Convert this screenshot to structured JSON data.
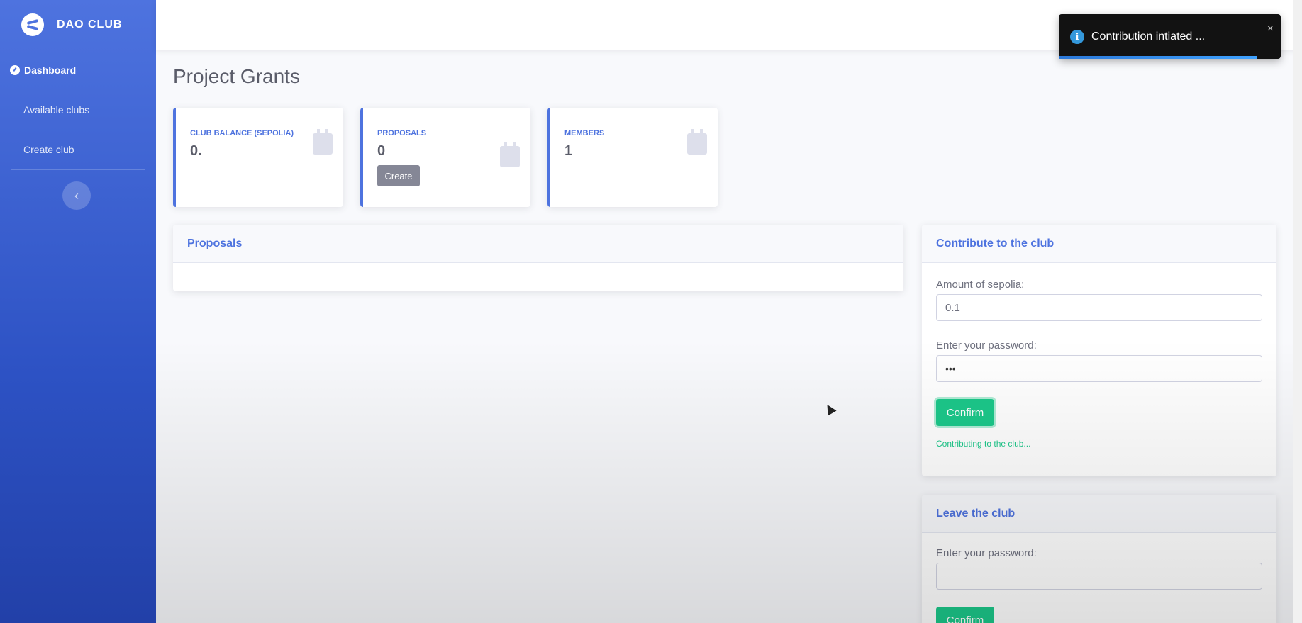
{
  "brand": {
    "name": "DAO CLUB"
  },
  "sidebar": {
    "items": [
      {
        "label": "Dashboard",
        "active": true
      },
      {
        "label": "Available clubs"
      },
      {
        "label": "Create club"
      }
    ],
    "toggle_glyph": "‹"
  },
  "page": {
    "title": "Project Grants"
  },
  "stats": {
    "balance": {
      "label": "CLUB BALANCE (SEPOLIA)",
      "value": "0."
    },
    "proposals": {
      "label": "PROPOSALS",
      "value": "0",
      "button": "Create"
    },
    "members": {
      "label": "MEMBERS",
      "value": "1"
    }
  },
  "proposals_card": {
    "title": "Proposals"
  },
  "contribute": {
    "title": "Contribute to the club",
    "amount_label": "Amount of sepolia:",
    "amount_value": "0.1",
    "password_label": "Enter your password:",
    "password_value": "•••",
    "confirm": "Confirm",
    "status": "Contributing to the club..."
  },
  "leave": {
    "title": "Leave the club",
    "password_label": "Enter your password:",
    "password_value": "",
    "confirm": "Confirm"
  },
  "toast": {
    "message": "Contribution intiated ...",
    "icon": "i",
    "close": "×",
    "progress_fraction": 0.89
  },
  "colors": {
    "primary": "#4e73df",
    "success": "#1cc88a",
    "secondary": "#858796"
  }
}
